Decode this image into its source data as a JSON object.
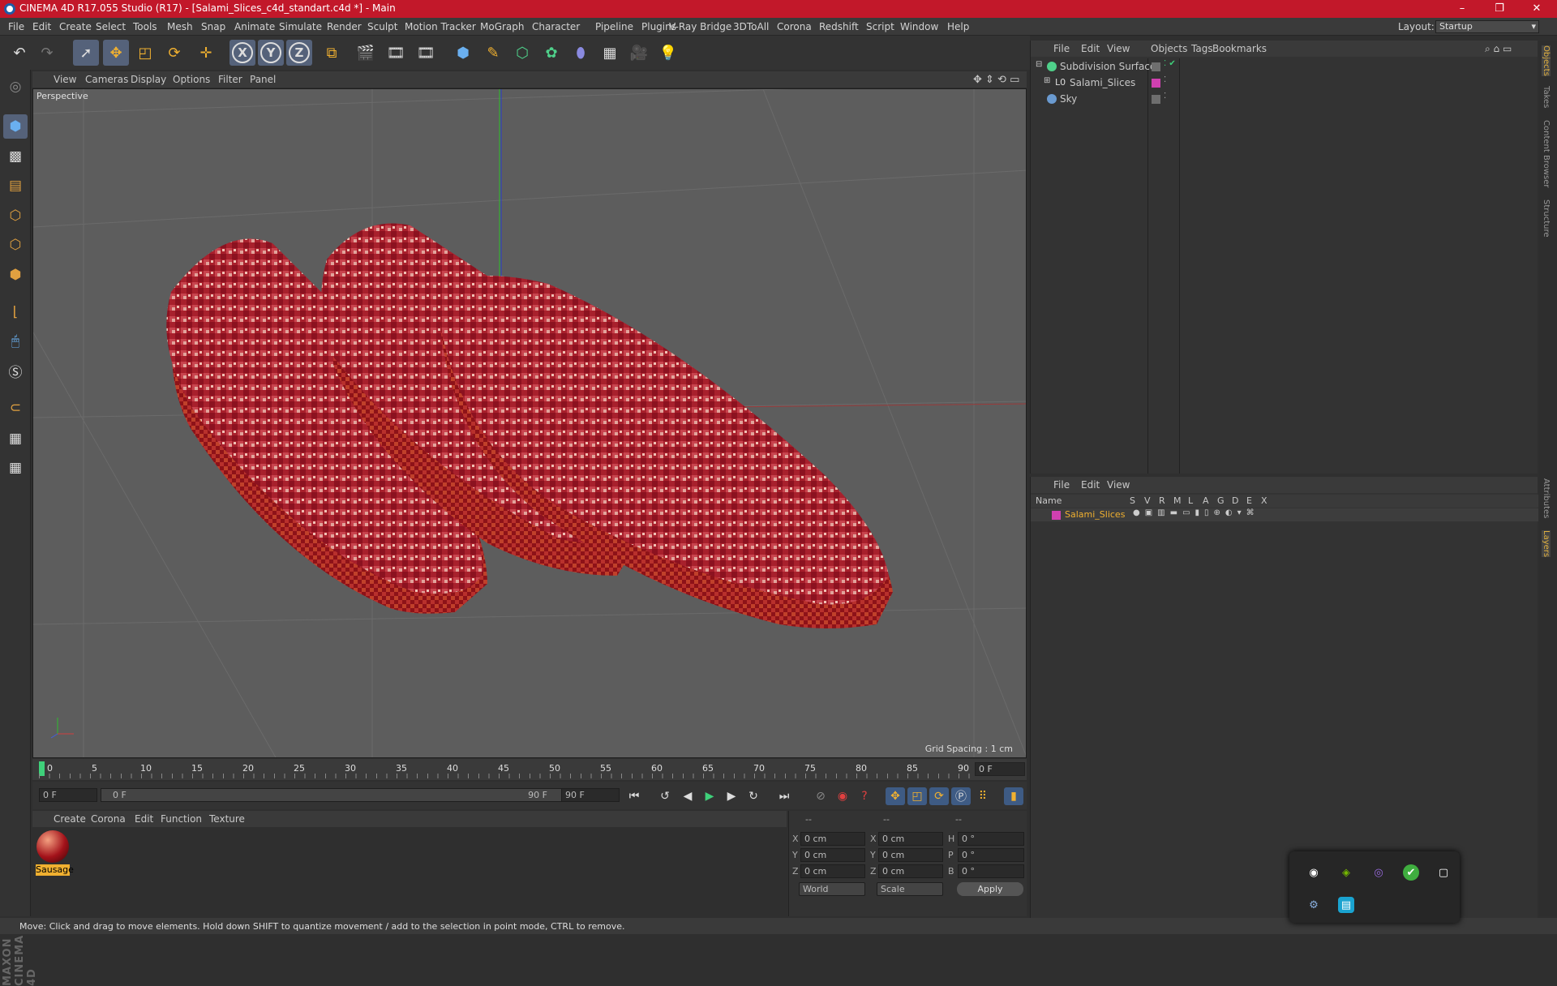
{
  "title_bar": {
    "text": "CINEMA 4D R17.055 Studio (R17) - [Salami_Slices_c4d_standart.c4d *] - Main",
    "minimize": "–",
    "maximize": "❐",
    "close": "✕"
  },
  "menu": {
    "items": [
      "File",
      "Edit",
      "Create",
      "Select",
      "Tools",
      "Mesh",
      "Snap",
      "Animate",
      "Simulate",
      "Render",
      "Sculpt",
      "Motion Tracker",
      "MoGraph",
      "Character",
      "Pipeline",
      "Plugins",
      "V-Ray Bridge",
      "3DToAll",
      "Corona",
      "Redshift",
      "Script",
      "Window",
      "Help"
    ],
    "layout_label": "Layout:",
    "layout_value": "Startup"
  },
  "toolbar": {
    "undo": "↶",
    "redo": "↷",
    "x": "X",
    "y": "Y",
    "z": "Z"
  },
  "viewport": {
    "menu": [
      "View",
      "Cameras",
      "Display",
      "Options",
      "Filter",
      "Panel"
    ],
    "label": "Perspective",
    "grid_spacing": "Grid Spacing : 1 cm"
  },
  "timeline": {
    "ticks": [
      "0",
      "5",
      "10",
      "15",
      "20",
      "25",
      "30",
      "35",
      "40",
      "45",
      "50",
      "55",
      "60",
      "65",
      "70",
      "75",
      "80",
      "85",
      "90"
    ],
    "current_frame": "0 F"
  },
  "transport": {
    "start": "0 F",
    "range_start": "0 F",
    "range_end": "90 F",
    "end": "90 F"
  },
  "material_manager": {
    "menu": [
      "Create",
      "Corona",
      "Edit",
      "Function",
      "Texture"
    ],
    "materials": [
      {
        "name": "Sausage"
      }
    ]
  },
  "coords": {
    "header": [
      "--",
      "--",
      "--"
    ],
    "rows": [
      {
        "a": "X",
        "av": "0 cm",
        "b": "X",
        "bv": "0 cm",
        "c": "H",
        "cv": "0 °"
      },
      {
        "a": "Y",
        "av": "0 cm",
        "b": "Y",
        "bv": "0 cm",
        "c": "P",
        "cv": "0 °"
      },
      {
        "a": "Z",
        "av": "0 cm",
        "b": "Z",
        "bv": "0 cm",
        "c": "B",
        "cv": "0 °"
      }
    ],
    "world": "World",
    "scale": "Scale",
    "apply": "Apply"
  },
  "object_manager": {
    "menu": [
      "File",
      "Edit",
      "View",
      "Objects",
      "Tags",
      "Bookmarks"
    ],
    "objects": [
      {
        "name": "Subdivision Surface",
        "color": "#6e6e6e"
      },
      {
        "name": "Salami_Slices",
        "color": "#d040b0"
      },
      {
        "name": "Sky",
        "color": "#6e6e6e"
      }
    ]
  },
  "layer_manager": {
    "menu": [
      "File",
      "Edit",
      "View"
    ],
    "columns": [
      "Name",
      "S",
      "V",
      "R",
      "M",
      "L",
      "A",
      "G",
      "D",
      "E",
      "X"
    ],
    "layers": [
      {
        "name": "Salami_Slices",
        "color": "#d040b0"
      }
    ]
  },
  "right_tabs": [
    "Objects",
    "Takes",
    "Content Browser",
    "Structure",
    "Attributes",
    "Layers"
  ],
  "status": "Move: Click and drag to move elements. Hold down SHIFT to quantize movement / add to the selection in point mode, CTRL to remove.",
  "maxon": "MAXON CINEMA 4D",
  "colors": {
    "accent": "#c2182a",
    "selected": "#55627a",
    "highlight": "#f0b030"
  }
}
